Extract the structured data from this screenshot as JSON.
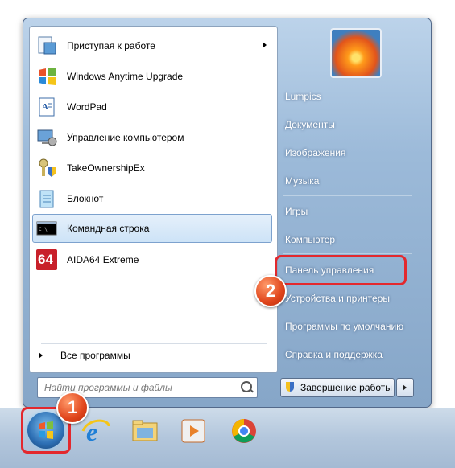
{
  "programs": [
    {
      "label": "Приступая к работе",
      "icon": "getting-started-icon",
      "has_submenu": true
    },
    {
      "label": "Windows Anytime Upgrade",
      "icon": "windows-flag-icon"
    },
    {
      "label": "WordPad",
      "icon": "wordpad-icon"
    },
    {
      "label": "Управление компьютером",
      "icon": "computer-management-icon"
    },
    {
      "label": "TakeOwnershipEx",
      "icon": "take-ownership-icon"
    },
    {
      "label": "Блокнот",
      "icon": "notepad-icon"
    },
    {
      "label": "Командная строка",
      "icon": "command-prompt-icon",
      "highlighted": true
    },
    {
      "label": "AIDA64 Extreme",
      "icon": "aida64-icon",
      "icon_text": "64"
    }
  ],
  "all_programs": "Все программы",
  "search_placeholder": "Найти программы и файлы",
  "right_links": [
    "Lumpics",
    "Документы",
    "Изображения",
    "Музыка",
    "Игры",
    "Компьютер",
    "Панель управления",
    "Устройства и принтеры",
    "Программы по умолчанию",
    "Справка и поддержка"
  ],
  "shutdown_label": "Завершение работы",
  "callouts": {
    "start": "1",
    "control_panel": "2"
  },
  "colors": {
    "callout_red": "#e3282d",
    "highlight": "#cde3f7"
  }
}
